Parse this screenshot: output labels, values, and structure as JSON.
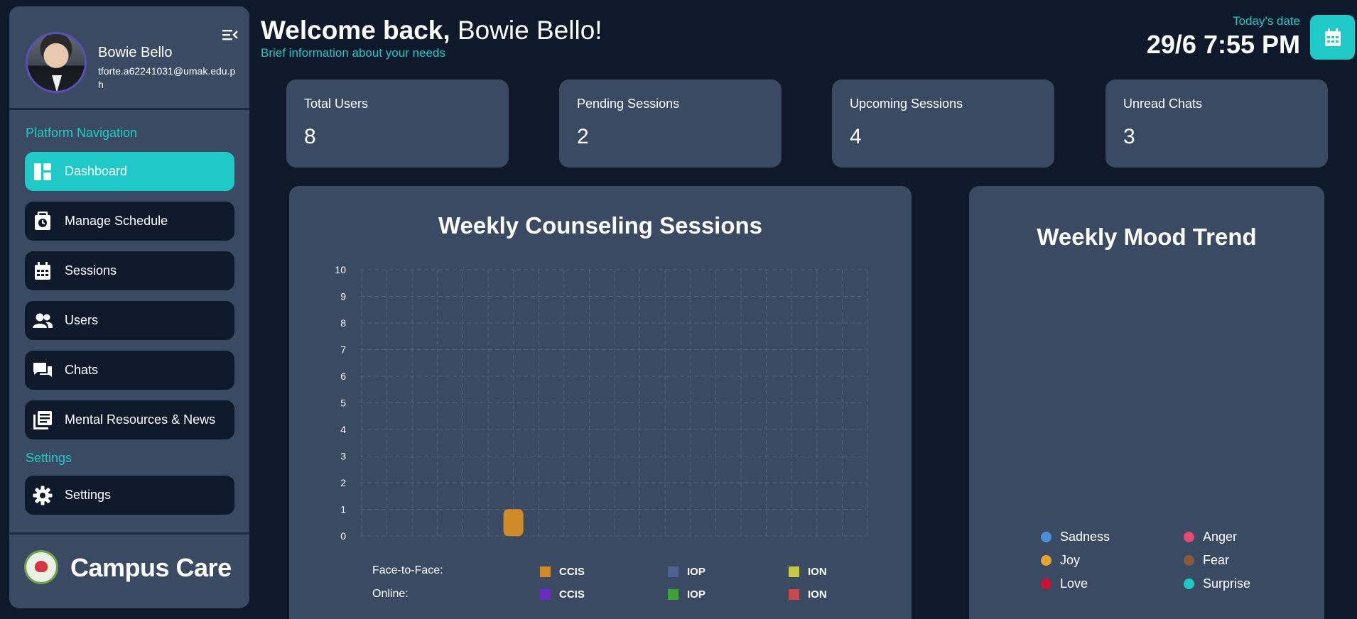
{
  "profile": {
    "name": "Bowie Bello",
    "email": "tforte.a62241031@umak.edu.ph"
  },
  "sidebar": {
    "nav_label": "Platform Navigation",
    "items": [
      {
        "label": "Dashboard",
        "icon": "dashboard-icon",
        "active": true
      },
      {
        "label": "Manage Schedule",
        "icon": "schedule-icon"
      },
      {
        "label": "Sessions",
        "icon": "calendar-icon"
      },
      {
        "label": "Users",
        "icon": "users-icon"
      },
      {
        "label": "Chats",
        "icon": "chat-icon"
      },
      {
        "label": "Mental Resources & News",
        "icon": "news-icon"
      }
    ],
    "settings_label": "Settings",
    "settings_item": {
      "label": "Settings",
      "icon": "gear-icon"
    }
  },
  "brand": {
    "name": "Campus Care"
  },
  "header": {
    "welcome_prefix": "Welcome back,",
    "welcome_name": "Bowie Bello!",
    "subtitle": "Brief information about your needs",
    "date_label": "Today's date",
    "date_value": "29/6 7:55 PM"
  },
  "stats": [
    {
      "label": "Total Users",
      "value": "8"
    },
    {
      "label": "Pending Sessions",
      "value": "2"
    },
    {
      "label": "Upcoming Sessions",
      "value": "4"
    },
    {
      "label": "Unread Chats",
      "value": "3"
    }
  ],
  "chart_data": [
    {
      "type": "scatter",
      "title": "Weekly Counseling Sessions",
      "ylim": [
        0,
        10
      ],
      "yticks": [
        "0",
        "1",
        "2",
        "3",
        "4",
        "5",
        "6",
        "7",
        "8",
        "9",
        "10"
      ],
      "grid": true,
      "points": [
        {
          "x_index": 6,
          "y": 0.5,
          "color": "#cf8a2a"
        }
      ],
      "legend": {
        "rows": [
          {
            "label": "Face-to-Face:",
            "items": [
              {
                "name": "CCIS",
                "color": "#cf8a2a"
              },
              {
                "name": "IOP",
                "color": "#4f6291"
              },
              {
                "name": "ION",
                "color": "#c3c845"
              }
            ]
          },
          {
            "label": "Online:",
            "items": [
              {
                "name": "CCIS",
                "color": "#6a2bbf"
              },
              {
                "name": "IOP",
                "color": "#3fa034"
              },
              {
                "name": "ION",
                "color": "#c74a4a"
              }
            ]
          }
        ]
      }
    },
    {
      "type": "line",
      "title": "Weekly Mood Trend",
      "series": [
        {
          "name": "Sadness",
          "color": "#4a90d9",
          "values": []
        },
        {
          "name": "Anger",
          "color": "#e44a72",
          "values": []
        },
        {
          "name": "Joy",
          "color": "#e8a32e",
          "values": []
        },
        {
          "name": "Fear",
          "color": "#8a5a3c",
          "values": []
        },
        {
          "name": "Love",
          "color": "#d01030",
          "values": []
        },
        {
          "name": "Surprise",
          "color": "#1fc9c6",
          "values": []
        }
      ]
    }
  ]
}
